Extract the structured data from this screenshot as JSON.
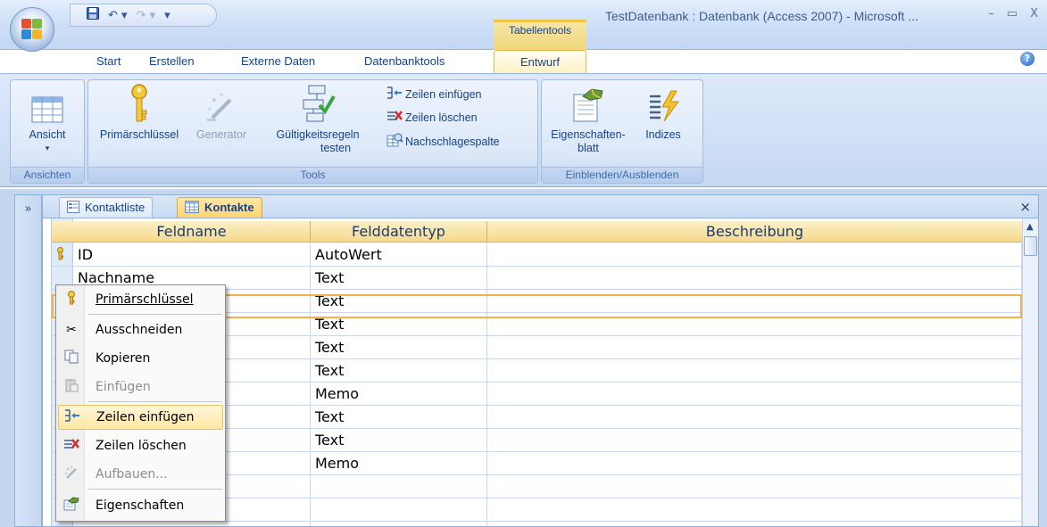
{
  "window": {
    "title": "TestDatenbank : Datenbank (Access 2007) - Microsoft ...",
    "controls": [
      "–",
      "▭",
      "X"
    ],
    "context_group": "Tabellentools"
  },
  "ribbon_tabs": [
    {
      "label": "Start"
    },
    {
      "label": "Erstellen"
    },
    {
      "label": "Externe Daten"
    },
    {
      "label": "Datenbanktools"
    },
    {
      "label": "Entwurf",
      "active": true
    }
  ],
  "ribbon": {
    "groups": {
      "ansichten": {
        "label": "Ansichten",
        "ansicht": "Ansicht",
        "dropdown": "▾"
      },
      "tools": {
        "label": "Tools",
        "primaerschluessel": "Primärschlüssel",
        "generator": "Generator",
        "gueltigkeit_1": "Gültigkeitsregeln",
        "gueltigkeit_2": "testen",
        "zeilen_einfuegen": "Zeilen einfügen",
        "zeilen_loeschen": "Zeilen löschen",
        "nachschlagespalte": "Nachschlagespalte"
      },
      "einblenden": {
        "label": "Einblenden/Ausblenden",
        "eigenschaften_1": "Eigenschaften-",
        "eigenschaften_2": "blatt",
        "indizes": "Indizes"
      }
    }
  },
  "nav_pane": {
    "toggle": "»"
  },
  "doc_tabs": [
    {
      "label": "Kontaktliste"
    },
    {
      "label": "Kontakte",
      "active": true
    }
  ],
  "doc_close": "×",
  "table": {
    "headers": [
      "Feldname",
      "Felddatentyp",
      "Beschreibung"
    ],
    "rows": [
      {
        "name": "ID",
        "type": "AutoWert",
        "desc": "",
        "key": true
      },
      {
        "name": "Nachname",
        "type": "Text",
        "desc": ""
      },
      {
        "name": "",
        "type": "Text",
        "desc": ""
      },
      {
        "name": "",
        "type": "Text",
        "desc": ""
      },
      {
        "name": "",
        "type": "Text",
        "desc": ""
      },
      {
        "name": "",
        "type": "Text",
        "desc": ""
      },
      {
        "name": "",
        "type": "Memo",
        "desc": ""
      },
      {
        "name": "",
        "type": "Text",
        "desc": ""
      },
      {
        "name": "",
        "type": "Text",
        "desc": ""
      },
      {
        "name": "",
        "type": "Memo",
        "desc": ""
      },
      {
        "name": "",
        "type": "",
        "desc": ""
      },
      {
        "name": "",
        "type": "",
        "desc": ""
      },
      {
        "name": "",
        "type": "",
        "desc": ""
      }
    ]
  },
  "context_menu": {
    "items": [
      {
        "label": "Primärschlüssel",
        "icon": "key-icon",
        "disabled": false
      },
      {
        "label": "Ausschneiden",
        "icon": "scissors-icon",
        "disabled": false
      },
      {
        "label": "Kopieren",
        "icon": "copy-icon",
        "disabled": false
      },
      {
        "label": "Einfügen",
        "icon": "paste-icon",
        "disabled": true
      },
      {
        "label": "Zeilen einfügen",
        "icon": "insert-rows-icon",
        "disabled": false,
        "highlighted": true
      },
      {
        "label": "Zeilen löschen",
        "icon": "delete-rows-icon",
        "disabled": false
      },
      {
        "label": "Aufbauen...",
        "icon": "build-icon",
        "disabled": true
      },
      {
        "label": "Eigenschaften",
        "icon": "properties-icon",
        "disabled": false
      }
    ]
  },
  "colors": {
    "accent_orange": "#f0b050",
    "ribbon_blue": "#cfdff6",
    "header_gold": "#f6d88b",
    "text_blue": "#15428b"
  }
}
